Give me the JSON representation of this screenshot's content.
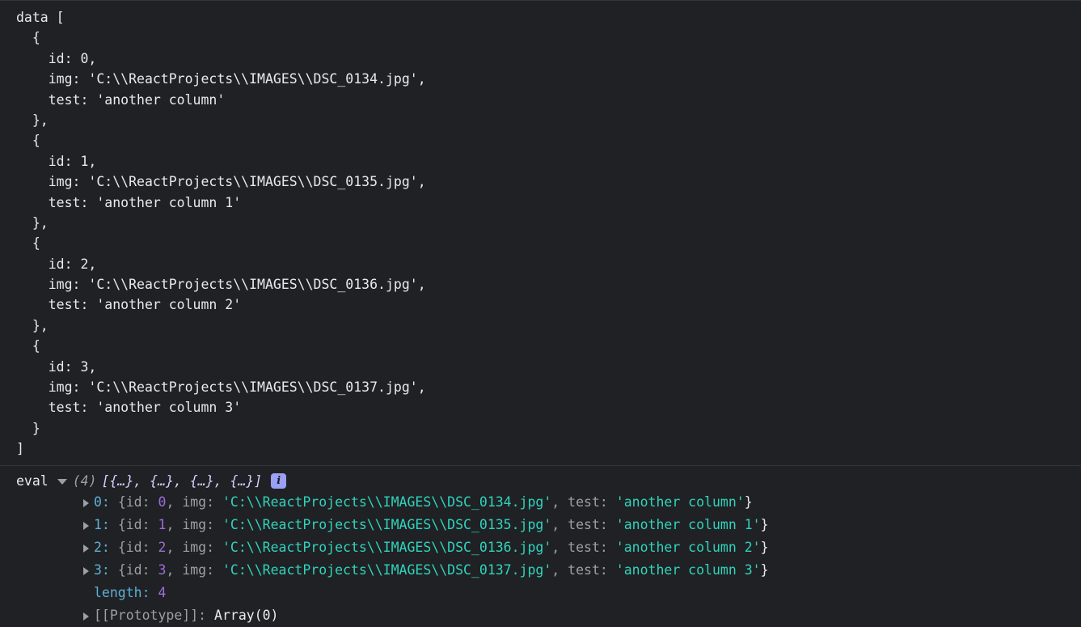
{
  "theme": {
    "background": "#202124",
    "default_text": "#e8eaed",
    "property_key": "#9aa0a6",
    "index_key": "#5db0d7",
    "number": "#9a6ddb",
    "string": "#2fd4bd",
    "divider": "#313438",
    "info_badge_bg": "#9aa0f5",
    "preview_text": "#cfd3ff"
  },
  "source_block": {
    "name": "data",
    "lines": [
      "data [",
      "  {",
      "    id: 0,",
      "    img: 'C:\\\\ReactProjects\\\\IMAGES\\\\DSC_0134.jpg',",
      "    test: 'another column'",
      "  },",
      "  {",
      "    id: 1,",
      "    img: 'C:\\\\ReactProjects\\\\IMAGES\\\\DSC_0135.jpg',",
      "    test: 'another column 1'",
      "  },",
      "  {",
      "    id: 2,",
      "    img: 'C:\\\\ReactProjects\\\\IMAGES\\\\DSC_0136.jpg',",
      "    test: 'another column 2'",
      "  },",
      "  {",
      "    id: 3,",
      "    img: 'C:\\\\ReactProjects\\\\IMAGES\\\\DSC_0137.jpg',",
      "    test: 'another column 3'",
      "  }",
      "]"
    ]
  },
  "eval_block": {
    "label": "eval",
    "expanded": true,
    "count": "(4)",
    "preview": "[{…}, {…}, {…}, {…}]",
    "info_icon": "info-icon",
    "info_glyph": "i",
    "open_brace": "{",
    "close_brace": "}",
    "comma": ", ",
    "colon": ": ",
    "keys": {
      "id": "id:",
      "img": "img:",
      "test": "test:"
    },
    "rows": [
      {
        "index": "0:",
        "id": "0",
        "img": "'C:\\\\ReactProjects\\\\IMAGES\\\\DSC_0134.jpg'",
        "test": "'another column'"
      },
      {
        "index": "1:",
        "id": "1",
        "img": "'C:\\\\ReactProjects\\\\IMAGES\\\\DSC_0135.jpg'",
        "test": "'another column 1'"
      },
      {
        "index": "2:",
        "id": "2",
        "img": "'C:\\\\ReactProjects\\\\IMAGES\\\\DSC_0136.jpg'",
        "test": "'another column 2'"
      },
      {
        "index": "3:",
        "id": "3",
        "img": "'C:\\\\ReactProjects\\\\IMAGES\\\\DSC_0137.jpg'",
        "test": "'another column 3'"
      }
    ],
    "length_key": "length:",
    "length_value": "4",
    "prototype_key": "[[Prototype]]:",
    "prototype_value": "Array(0)"
  }
}
